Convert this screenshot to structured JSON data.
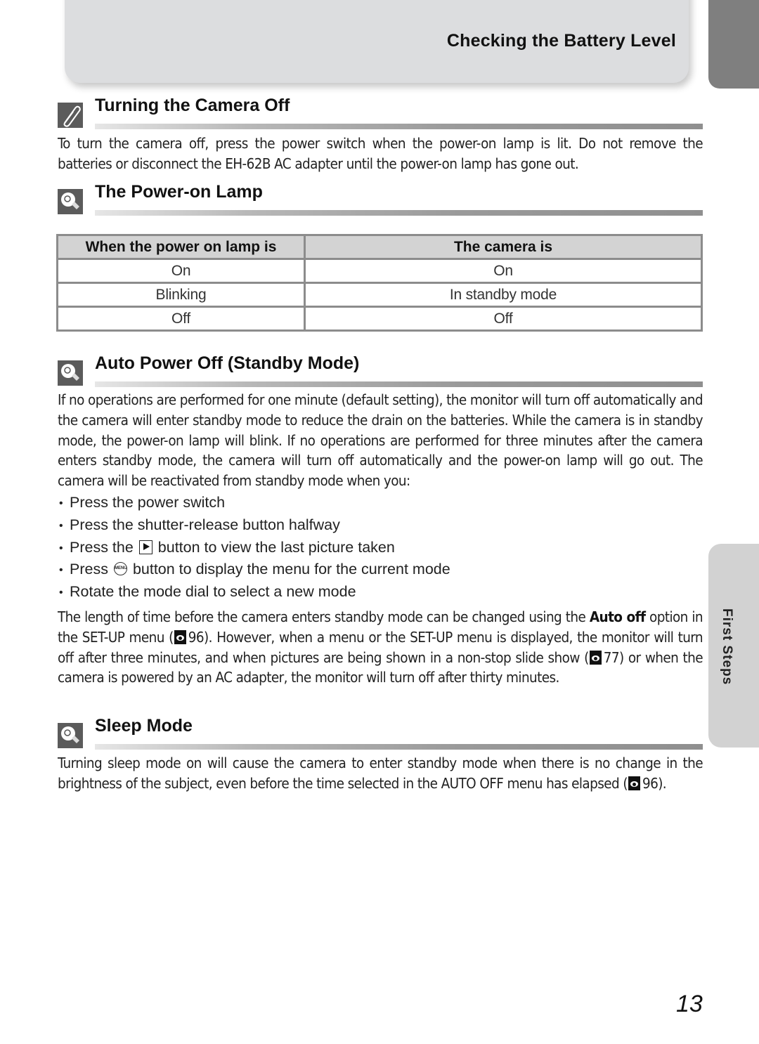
{
  "header": {
    "title": "Checking the Battery Level"
  },
  "side_tab": {
    "label": "First Steps"
  },
  "sections": {
    "turning_off": {
      "title": "Turning the Camera Off",
      "icon": "paperclip-note-icon",
      "body": "To turn the camera off, press the power switch when the power-on lamp is lit. Do not remove the batteries or disconnect the EH-62B AC adapter until the power-on lamp has gone out."
    },
    "power_lamp": {
      "title": "The Power-on Lamp",
      "icon": "lightbulb-tip-icon",
      "table": {
        "headers": [
          "When the power on lamp is",
          "The camera is"
        ],
        "rows": [
          [
            "On",
            "On"
          ],
          [
            "Blinking",
            "In standby mode"
          ],
          [
            "Off",
            "Off"
          ]
        ]
      }
    },
    "auto_power_off": {
      "title": "Auto Power Off (Standby Mode)",
      "icon": "lightbulb-tip-icon",
      "body": "If no operations are performed for one minute (default setting), the monitor will turn off automatically and the camera will enter standby mode to reduce the drain on the batteries. While the camera is in standby mode, the power-on lamp will blink. If no operations are performed for three minutes after the camera enters standby mode, the camera will turn off automatically and the power-on lamp will go out. The camera will be reactivated from standby mode when you:",
      "bullets": [
        {
          "pre": "Press the power switch"
        },
        {
          "pre": "Press the shutter-release button halfway"
        },
        {
          "pre": "Press the",
          "icon": "play-button-icon",
          "post": "button to view the last picture taken"
        },
        {
          "pre": "Press",
          "icon": "menu-button-icon",
          "icon_text": "MENU",
          "post": "button to display the menu for the current mode"
        },
        {
          "pre": "Rotate the mode dial to select a new mode"
        }
      ],
      "body2": {
        "p1": "The length of time before the camera enters standby mode can be changed using the ",
        "bold1": "Auto off",
        "p2": " option in the SET-UP menu (",
        "ref1": "96",
        "p3": "). However, when a menu or the SET-UP menu is displayed, the monitor will turn off after three minutes, and when pictures are being shown in a non-stop slide show (",
        "ref2": "77",
        "p4": ") or when the camera is powered by an AC adapter, the monitor will turn off after thirty minutes."
      }
    },
    "sleep_mode": {
      "title": "Sleep Mode",
      "icon": "lightbulb-tip-icon",
      "body_pre": "Turning sleep mode on will cause the camera to enter standby mode when there is no change in the brightness of the subject, even before the time selected in the AUTO OFF menu has elapsed (",
      "ref": "96",
      "body_post": ")."
    }
  },
  "page_number": "13"
}
